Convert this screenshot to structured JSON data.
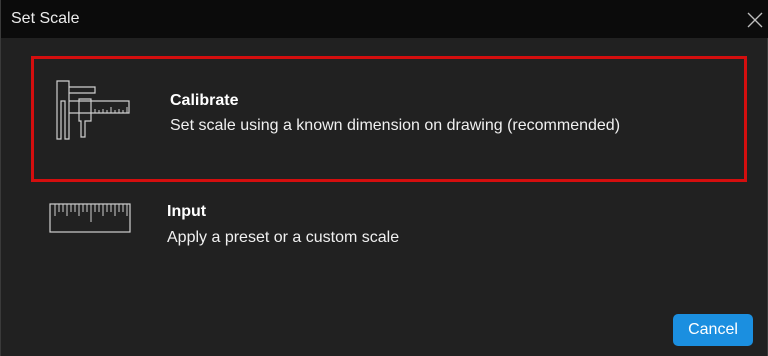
{
  "dialog": {
    "title": "Set Scale",
    "close_icon": "close-icon"
  },
  "options": [
    {
      "title": "Calibrate",
      "description": "Set scale using a known dimension on drawing (recommended)",
      "icon": "caliper-icon",
      "selected": true,
      "highlight_color": "#d40e0e"
    },
    {
      "title": "Input",
      "description": "Apply a preset or a custom scale",
      "icon": "ruler-icon",
      "selected": false
    }
  ],
  "footer": {
    "cancel_label": "Cancel"
  },
  "colors": {
    "background": "#212121",
    "titlebar": "#0b0b0b",
    "accent": "#1b8fe0",
    "text": "#ffffff"
  }
}
